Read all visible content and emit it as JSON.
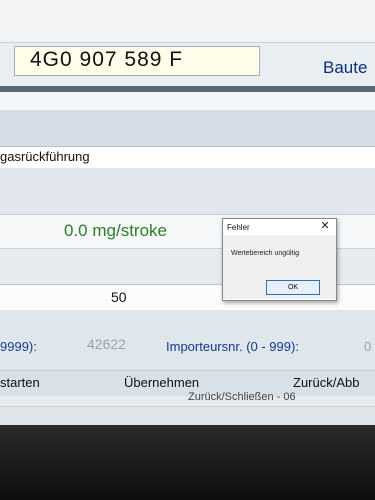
{
  "header": {
    "part_number": "4G0 907 589 F",
    "bau_label": "Baute"
  },
  "form": {
    "field_label": "gasrückführung",
    "measured_value": "0.0 mg/stroke",
    "number_value": "50"
  },
  "importer": {
    "range_left": "9999):",
    "dealer_value": "42622",
    "importer_label": "Importeursnr. (0 - 999):",
    "importer_value": "0"
  },
  "buttons": {
    "start": "starten",
    "apply": "Übernehmen",
    "back": "Zurück/Abb"
  },
  "status": {
    "text": "Zurück/Schließen - 06"
  },
  "dialog": {
    "title": "Fehler",
    "close_glyph": "✕",
    "message": "Wertebereich ungültig",
    "ok_label": "OK"
  }
}
